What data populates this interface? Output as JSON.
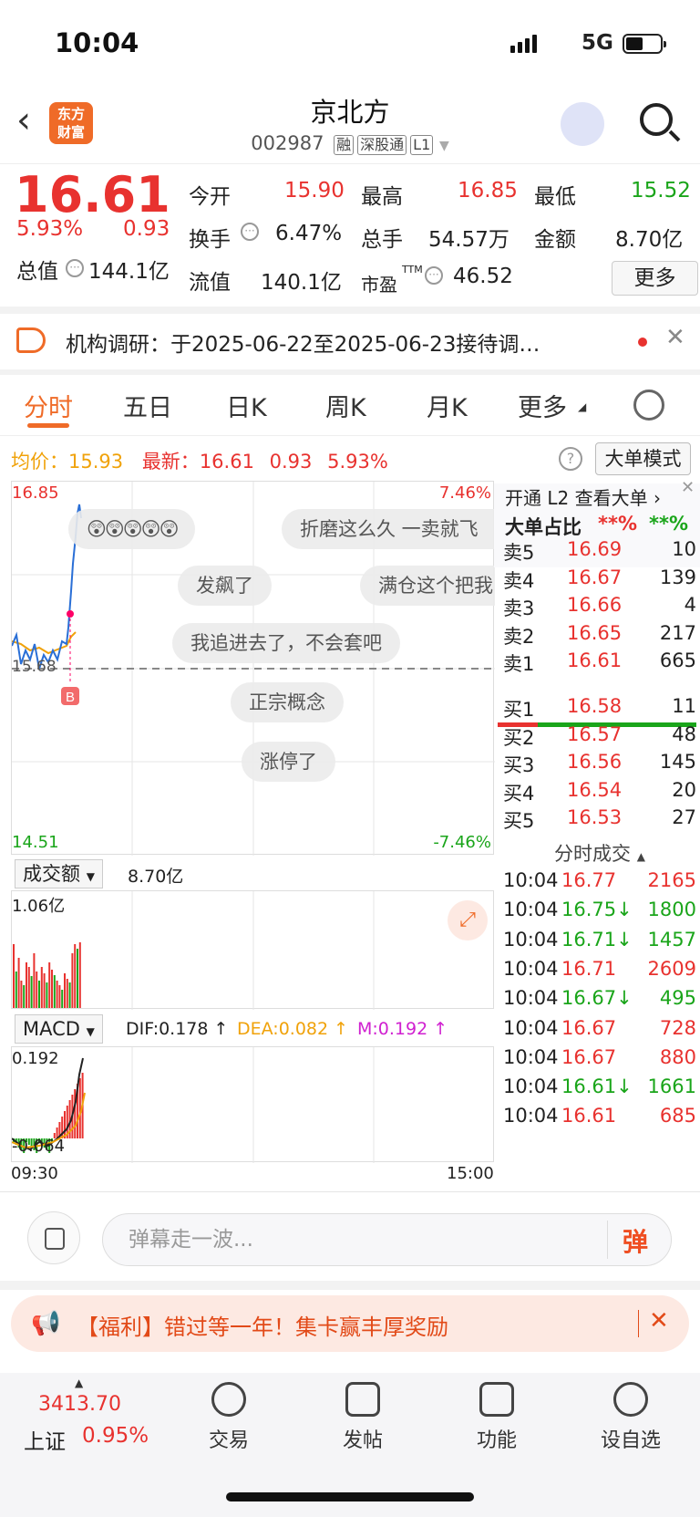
{
  "status": {
    "time": "10:04",
    "network": "5G"
  },
  "header": {
    "logo": "东方财富",
    "title": "京北方",
    "code": "002987",
    "tags": [
      "融",
      "深股通",
      "L1"
    ]
  },
  "quote": {
    "price": "16.61",
    "pct": "5.93%",
    "chg": "0.93",
    "open_label": "今开",
    "open": "15.90",
    "high_label": "最高",
    "high": "16.85",
    "low_label": "最低",
    "low": "15.52",
    "turnover_label": "换手",
    "turnover": "6.47%",
    "vol_label": "总手",
    "vol": "54.57万",
    "amount_label": "金额",
    "amount": "8.70亿",
    "mcap_label": "总值",
    "mcap": "144.1亿",
    "float_label": "流值",
    "float": "140.1亿",
    "pe_label": "市盈",
    "pe_sup": "TTM",
    "pe": "46.52",
    "more": "更多"
  },
  "notice": {
    "text": "机构调研：于2025-06-22至2025-06-23接待调…"
  },
  "tabs": [
    "分时",
    "五日",
    "日K",
    "周K",
    "月K",
    "更多"
  ],
  "intraday": {
    "avg_label": "均价：",
    "avg": "15.93",
    "latest_label": "最新：",
    "latest": "16.61",
    "chg": "0.93",
    "pct": "5.93%",
    "mode_btn": "大单模式",
    "top": "16.85",
    "top_pct": "7.46%",
    "bottom": "14.51",
    "bottom_pct": "-7.46%",
    "mid": "15.68",
    "marker": "B",
    "danmaku": [
      "折磨这么久 一卖就飞",
      "发飙了",
      "满仓这个把我",
      "我追进去了，不会套吧",
      "正宗概念",
      "涨停了"
    ]
  },
  "volume": {
    "label": "成交额",
    "total": "8.70亿",
    "max": "1.06亿"
  },
  "macd": {
    "label": "MACD",
    "dif": "DIF:0.178 ↑",
    "dea": "DEA:0.082 ↑",
    "m": "M:0.192 ↑",
    "top": "0.192",
    "bottom": "-0.064",
    "start": "09:30",
    "end": "15:00"
  },
  "orderbook": {
    "l2": "开通 L2 查看大单 ›",
    "ratio_label": "大单占比",
    "ratio_a": "**%",
    "ratio_b": "**%",
    "asks": [
      {
        "l": "卖5",
        "p": "16.69",
        "v": "10"
      },
      {
        "l": "卖4",
        "p": "16.67",
        "v": "139"
      },
      {
        "l": "卖3",
        "p": "16.66",
        "v": "4"
      },
      {
        "l": "卖2",
        "p": "16.65",
        "v": "217"
      },
      {
        "l": "卖1",
        "p": "16.61",
        "v": "665"
      }
    ],
    "bids": [
      {
        "l": "买1",
        "p": "16.58",
        "v": "11"
      },
      {
        "l": "买2",
        "p": "16.57",
        "v": "48"
      },
      {
        "l": "买3",
        "p": "16.56",
        "v": "145"
      },
      {
        "l": "买4",
        "p": "16.54",
        "v": "20"
      },
      {
        "l": "买5",
        "p": "16.53",
        "v": "27"
      }
    ],
    "ticks_label": "分时成交",
    "ticks": [
      {
        "t": "10:04",
        "p": "16.77",
        "v": "2165"
      },
      {
        "t": "10:04",
        "p": "16.75↓",
        "v": "1800"
      },
      {
        "t": "10:04",
        "p": "16.71↓",
        "v": "1457"
      },
      {
        "t": "10:04",
        "p": "16.71",
        "v": "2609"
      },
      {
        "t": "10:04",
        "p": "16.67↓",
        "v": "495"
      },
      {
        "t": "10:04",
        "p": "16.67",
        "v": "728"
      },
      {
        "t": "10:04",
        "p": "16.67",
        "v": "880"
      },
      {
        "t": "10:04",
        "p": "16.61↓",
        "v": "1661"
      },
      {
        "t": "10:04",
        "p": "16.61",
        "v": "685"
      }
    ]
  },
  "danmu": {
    "placeholder": "弹幕走一波...",
    "send": "弹"
  },
  "promo": {
    "text": "【福利】错过等一年！集卡赢丰厚奖励"
  },
  "nav": {
    "index": "3413.70",
    "index_name": "上证",
    "index_pct": "0.95%",
    "items": [
      "交易",
      "发帖",
      "功能",
      "设自选"
    ]
  }
}
